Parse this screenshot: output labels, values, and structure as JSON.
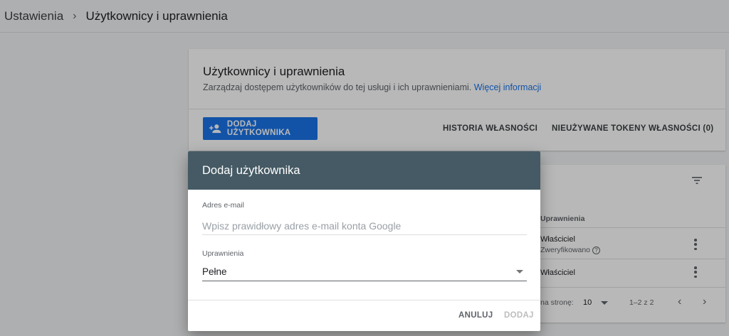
{
  "breadcrumb": {
    "parent": "Ustawienia",
    "separator": "›",
    "current": "Użytkownicy i uprawnienia"
  },
  "card": {
    "title": "Użytkownicy i uprawnienia",
    "subtitle": "Zarządzaj dostępem użytkowników do tej usługi i ich uprawnieniami.",
    "more_link": "Więcej informacji",
    "add_user_label": "DODAJ UŻYTKOWNIKA",
    "history_label": "HISTORIA WŁASNOŚCI",
    "tokens_label": "NIEUŻYWANE TOKENY WŁASNOŚCI (0)"
  },
  "table": {
    "header_permissions": "Uprawnienia",
    "rows": [
      {
        "role": "Właściciel",
        "status": "Zweryfikowano"
      },
      {
        "role": "Właściciel"
      }
    ],
    "rows_per_page_label": "na stronę:",
    "rows_per_page": "10",
    "range": "1–2 z 2"
  },
  "dialog": {
    "title": "Dodaj użytkownika",
    "email_label": "Adres e-mail",
    "email_placeholder": "Wpisz prawidłowy adres e-mail konta Google",
    "email_value": "",
    "permissions_label": "Uprawnienia",
    "permissions_value": "Pełne",
    "cancel_label": "ANULUJ",
    "add_label": "DODAJ"
  },
  "colors": {
    "accent": "#1a73e8",
    "dialog_header": "#455a64",
    "page_bg": "#f1f3f4",
    "disabled": "#bdbdbd"
  },
  "icons": [
    "chevron-right-icon",
    "add-user-icon",
    "filter-icon",
    "more-vert-icon",
    "help-icon",
    "dropdown-arrow-icon",
    "chevron-left-icon"
  ]
}
